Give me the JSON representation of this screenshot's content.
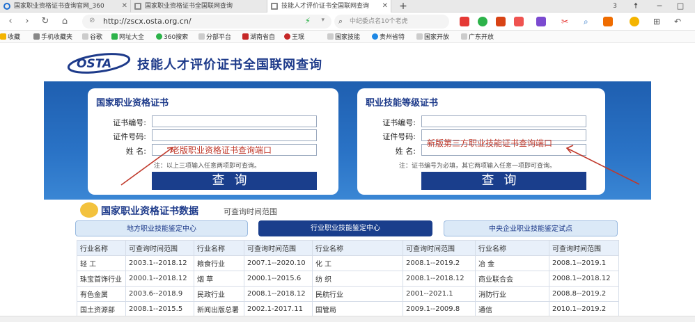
{
  "tabs": [
    {
      "label": "国家职业资格证书查询官网_360",
      "active": false
    },
    {
      "label": "国家职业资格证书全国联网查询",
      "active": false
    },
    {
      "label": "技能人才评价证书全国联网查询",
      "active": true
    }
  ],
  "window": {
    "new_tab": "+",
    "badge": "3",
    "shirt": "☨",
    "minimize": "−",
    "restore": "□"
  },
  "address": {
    "url": "http://zscx.osta.org.cn/"
  },
  "search": {
    "placeholder": "中纪委点名10个老虎"
  },
  "bookmarks": [
    "收藏",
    "手机收藏夹",
    "谷歌",
    "网址大全",
    "360搜索",
    "分部平台",
    "湖南省自",
    "王珉",
    "国家技能",
    "贵州省特",
    "国家开放",
    "广东开放"
  ],
  "page": {
    "site_title": "技能人才评价证书全国联网查询",
    "logo_text": "OSTA",
    "left_card": {
      "title": "国家职业资格证书",
      "fields": [
        "证书编号:",
        "证件号码:",
        "姓    名:"
      ],
      "annotation": "老版职业资格证书查询端口",
      "note": "注：以上三项输入任意两项即可查询。",
      "button": "查询"
    },
    "right_card": {
      "title": "职业技能等级证书",
      "fields": [
        "证书编号:",
        "证件号码:",
        "姓    名:"
      ],
      "annotation": "新版第三方职业技能证书查询端口",
      "note": "注：证书编号为必填，其它两项输入任意一项即可查询。",
      "button": "查询"
    },
    "data_section": {
      "title": "国家职业资格证书数据",
      "subtitle": "可查询时间范围",
      "tabs": [
        {
          "label": "地方职业技能鉴定中心",
          "active": false
        },
        {
          "label": "行业职业技能鉴定中心",
          "active": true
        },
        {
          "label": "中央企业职业技能鉴定试点",
          "active": false
        }
      ],
      "columns": [
        "行业名称",
        "可查询时间范围",
        "行业名称",
        "可查询时间范围",
        "行业名称",
        "可查询时间范围",
        "行业名称",
        "可查询时间范围"
      ],
      "rows": [
        [
          "轻  工",
          "2003.1--2018.12",
          "粮食行业",
          "2007.1--2020.10",
          "化  工",
          "2008.1--2019.2",
          "冶  金",
          "2008.1--2019.1"
        ],
        [
          "珠宝首饰行业",
          "2000.1--2018.12",
          "烟  草",
          "2000.1--2015.6",
          "纺  织",
          "2008.1--2018.12",
          "商业联合会",
          "2008.1--2018.12"
        ],
        [
          "有色金属",
          "2003.6--2018.9",
          "民政行业",
          "2008.1--2018.12",
          "民航行业",
          "2001--2021.1",
          "消防行业",
          "2008.8--2019.2"
        ],
        [
          "国土资源部",
          "2008.1--2015.5",
          "新闻出版总署",
          "2002.1-2017.11",
          "国管局",
          "2009.1--2009.8",
          "通信",
          "2010.1--2019.2"
        ]
      ]
    }
  },
  "colors": {
    "brand": "#1d3a8a",
    "banner": "#2a73c6",
    "annotation": "#c0392b"
  }
}
